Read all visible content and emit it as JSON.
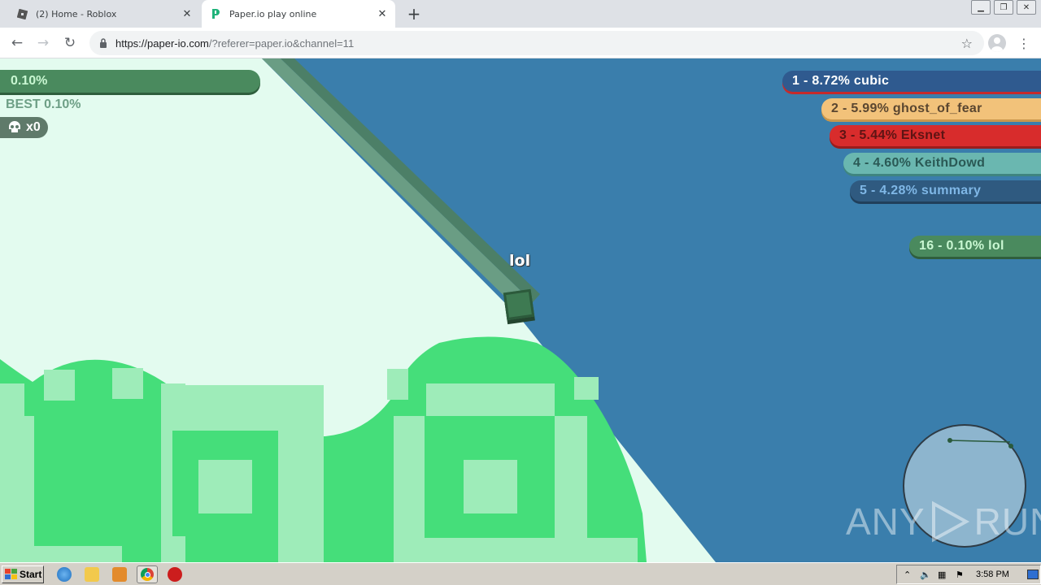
{
  "browser": {
    "tabs": [
      {
        "title": "(2) Home - Roblox",
        "active": false
      },
      {
        "title": "Paper.io play online",
        "active": true
      }
    ],
    "url_host": "https://paper-io.com",
    "url_rest": "/?referer=paper.io&channel=11"
  },
  "hud": {
    "percent": "0.10%",
    "best": "BEST 0.10%",
    "kills": "x0"
  },
  "leaderboard": [
    {
      "text": "1 - 8.72% cubic",
      "bg": "#2f5a8f",
      "color": "#ffffff",
      "shadow": "#c62a2a"
    },
    {
      "text": "2 - 5.99% ghost_of_fear",
      "bg": "#f2c27a",
      "color": "#5a4630",
      "shadow": "#c9974c"
    },
    {
      "text": "3 - 5.44% Eksnet",
      "bg": "#d82c2c",
      "color": "#5e1414",
      "shadow": "#9a1c1c"
    },
    {
      "text": "4 - 4.60% KeithDowd",
      "bg": "#6ab7b0",
      "color": "#2a5955",
      "shadow": "#3f8580"
    },
    {
      "text": "5 - 4.28% summary",
      "bg": "#2f5a80",
      "color": "#7fb7e6",
      "shadow": "#203f5b"
    }
  ],
  "own_rank": {
    "text": "16 - 0.10% lol",
    "bg": "#4a8a5e",
    "color": "#c9f7d2",
    "shadow": "#2f5e3d"
  },
  "player": {
    "name": "lol"
  },
  "watermark": {
    "left": "ANY",
    "right": "RUN"
  },
  "taskbar": {
    "start_label": "Start",
    "time": "3:58 PM"
  },
  "colors": {
    "sea": "#3a7eac",
    "own_territory": "#e3fbef",
    "trail": "#5f9a7e",
    "green_territory": "#45de7a",
    "green_light": "#9eecb9"
  }
}
